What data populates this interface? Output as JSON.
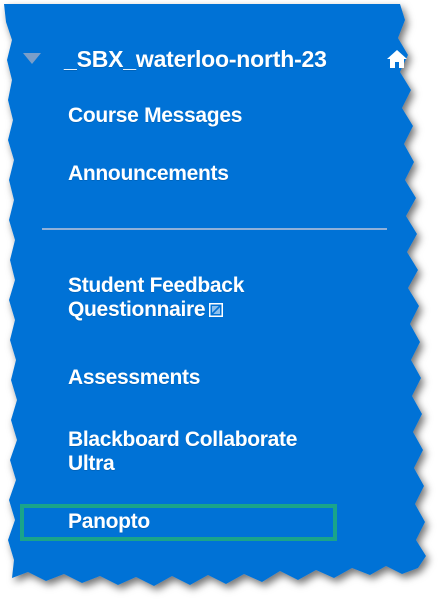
{
  "course": {
    "title": "_SBX_waterloo-north-23",
    "toggle_icon": "collapse-triangle-icon",
    "home_icon": "home-icon"
  },
  "menu_items": [
    {
      "label": "Course Messages"
    },
    {
      "label": "Announcements"
    },
    {
      "label_line1": "Student Feedback",
      "label_line2": "Questionnaire",
      "icon": "external-link-icon"
    },
    {
      "label": "Assessments"
    },
    {
      "label_line1": "Blackboard Collaborate",
      "label_line2": "Ultra"
    },
    {
      "label": "Panopto"
    }
  ],
  "colors": {
    "panel_blue": "#0072d6",
    "highlight_border": "#1aa48a",
    "text": "#ffffff"
  }
}
